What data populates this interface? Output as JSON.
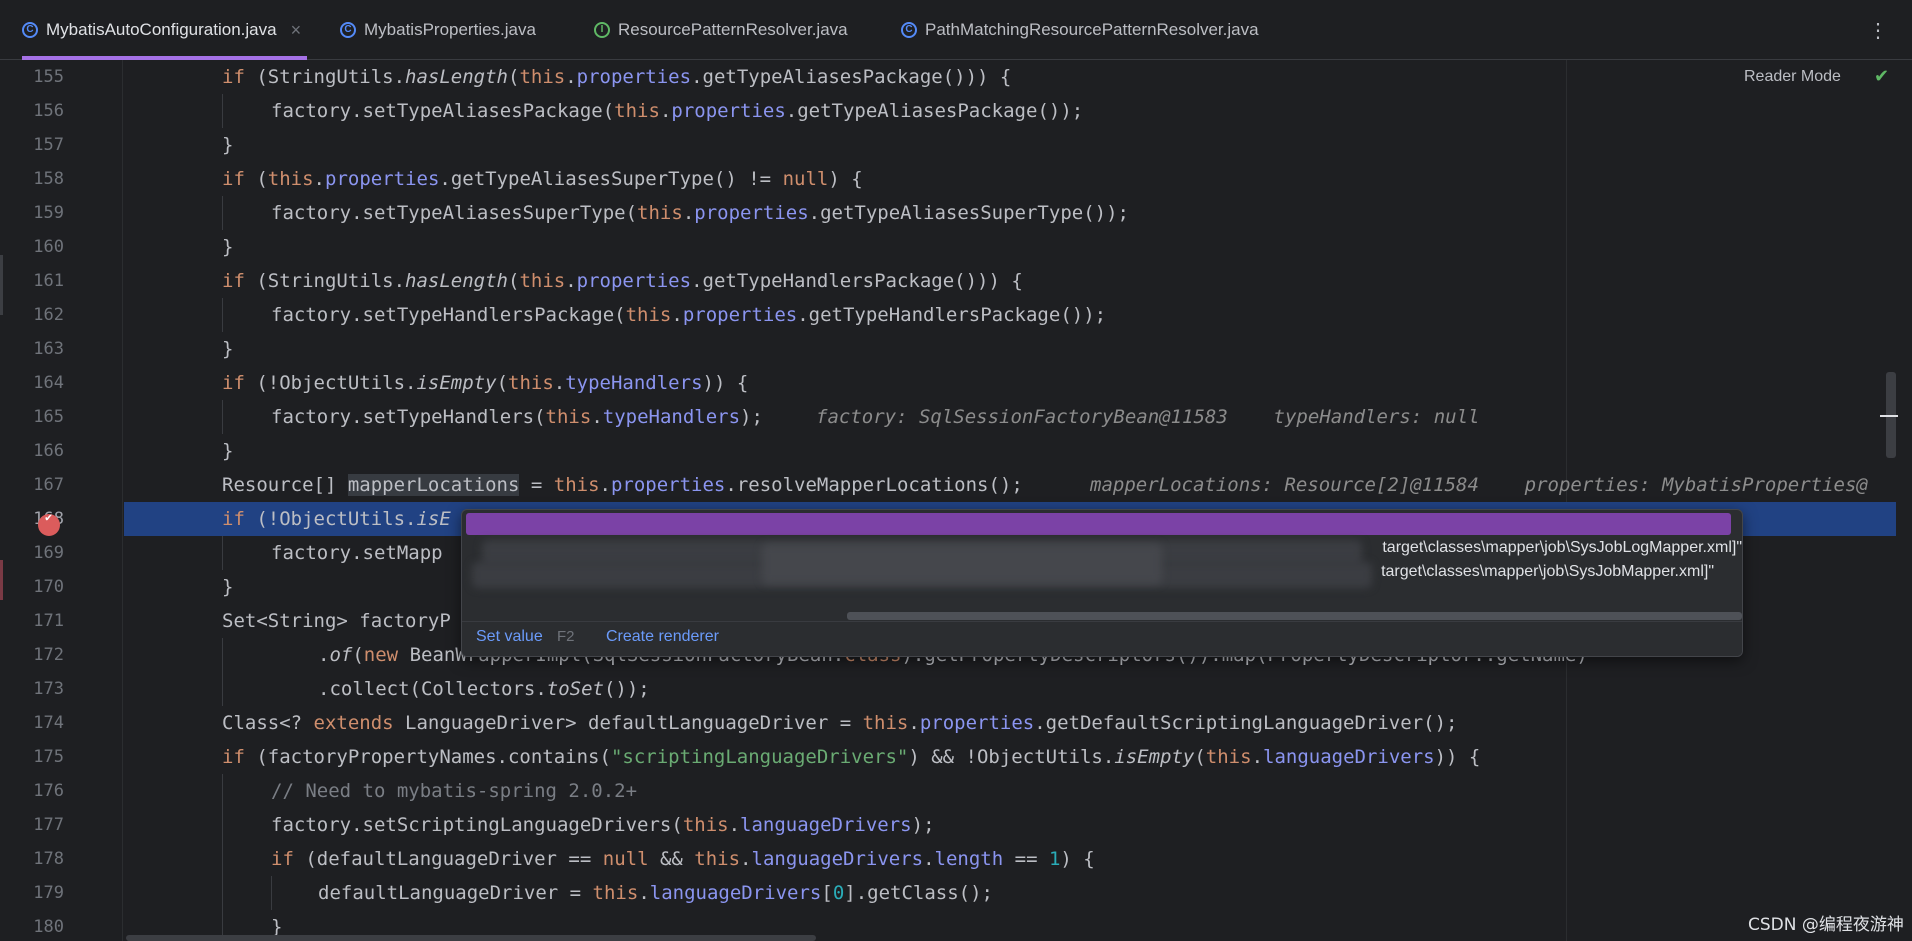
{
  "tabs": [
    {
      "label": "MybatisAutoConfiguration.java",
      "icon": "class-icon",
      "active": true,
      "closable": true
    },
    {
      "label": "MybatisProperties.java",
      "icon": "class-icon",
      "active": false
    },
    {
      "label": "ResourcePatternResolver.java",
      "icon": "interface-icon",
      "active": false
    },
    {
      "label": "PathMatchingResourcePatternResolver.java",
      "icon": "class-icon",
      "active": false
    }
  ],
  "tab_close": "×",
  "tab_more": "⋮",
  "icon_glyphs": {
    "class": "C",
    "interface": "I"
  },
  "reader_mode": "Reader Mode",
  "line_numbers": [
    "155",
    "156",
    "157",
    "158",
    "159",
    "160",
    "161",
    "162",
    "163",
    "164",
    "165",
    "166",
    "167",
    "168",
    "169",
    "170",
    "171",
    "172",
    "173",
    "174",
    "175",
    "176",
    "177",
    "178",
    "179",
    "180"
  ],
  "inline_values": {
    "l165": "factory: SqlSessionFactoryBean@11583    typeHandlers: null",
    "l167": "mapperLocations: Resource[2]@11584    properties: MybatisProperties@"
  },
  "popup": {
    "paths": [
      "target\\classes\\mapper\\job\\SysJobLogMapper.xml]\"",
      "target\\classes\\mapper\\job\\SysJobMapper.xml]\""
    ],
    "set_value": "Set value",
    "shortcut": "F2",
    "create_renderer": "Create renderer"
  },
  "watermark": "CSDN @编程夜游神",
  "colors": {
    "background": "#1e1f22",
    "keyword": "#cf8e6d",
    "field": "#c77dbb",
    "string": "#6aab73",
    "number": "#2aacb8",
    "selection": "#214283",
    "breakpoint": "#db5c5c",
    "popup_header": "#7b42a6",
    "link": "#6b9bfa"
  }
}
